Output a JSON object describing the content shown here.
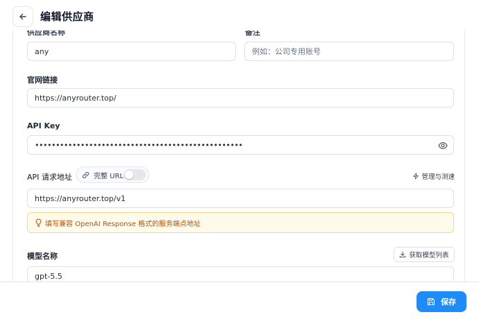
{
  "header": {
    "title": "编辑供应商",
    "back_icon": "arrow-left-icon"
  },
  "form": {
    "name_label": "供应商名称",
    "name_value": "any",
    "note_label": "备注",
    "note_placeholder": "例如：公司专用账号",
    "website_label": "官网链接",
    "website_value": "https://anyrouter.top/",
    "api_key_label": "API Key",
    "api_key_value": "••••••••••••••••••••••••••••••••••••••••••••••••••",
    "api_key_icon": "eye-icon",
    "endpoint_label": "API 请求地址",
    "full_url_label": "完整 URL",
    "full_url_enabled": false,
    "manage_label": "管理与测速",
    "endpoint_value": "https://anyrouter.top/v1",
    "tip_text": "填写兼容 OpenAI Response 格式的服务端点地址",
    "model_label": "模型名称",
    "fetch_models_label": "获取模型列表",
    "model_value": "gpt-5.5"
  },
  "footer": {
    "save_label": "保存"
  },
  "colors": {
    "accent": "#1d8cf8",
    "tip_background": "#fefbea",
    "tip_border": "#f3d98a",
    "tip_text": "#b45309"
  }
}
